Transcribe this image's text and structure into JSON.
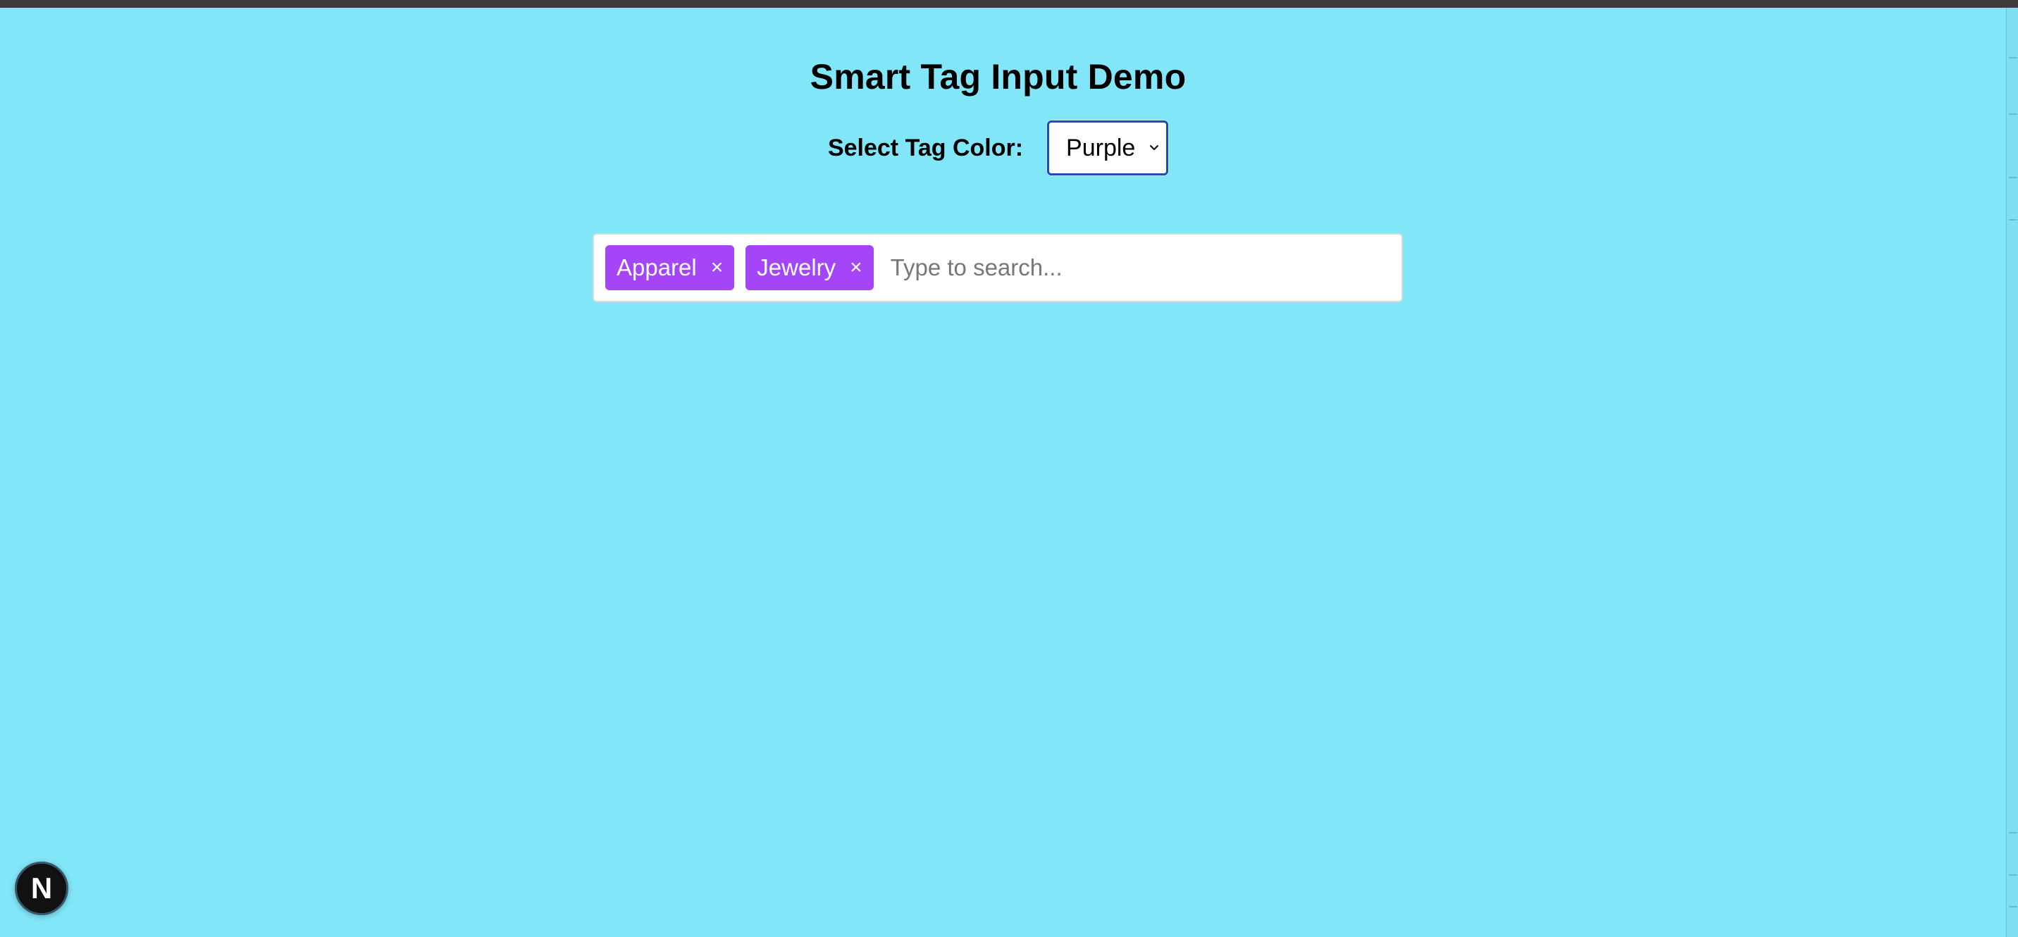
{
  "page": {
    "title": "Smart Tag Input Demo"
  },
  "color_picker": {
    "label": "Select Tag Color:",
    "selected": "Purple"
  },
  "tag_input": {
    "tags": [
      {
        "label": "Apparel",
        "remove_icon": "×"
      },
      {
        "label": "Jewelry",
        "remove_icon": "×"
      }
    ],
    "placeholder": "Type to search..."
  },
  "badge": {
    "text": "N"
  },
  "colors": {
    "background": "#81e6f8",
    "tag": "#a446f7",
    "select_border": "#1f4bb6"
  },
  "icons": {
    "select_arrow": "chevron-down-icon",
    "tag_remove": "close-icon",
    "badge": "next-logo-icon"
  }
}
